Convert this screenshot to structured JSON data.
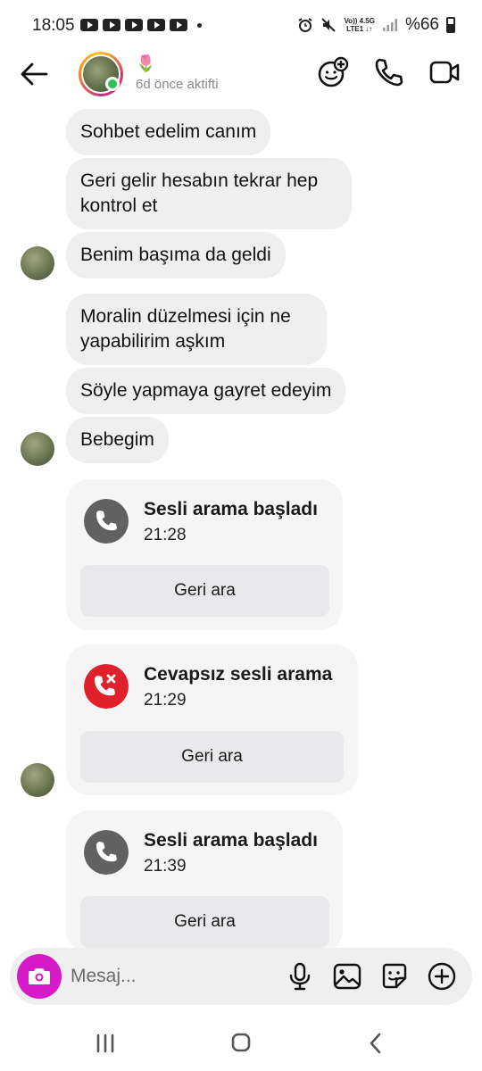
{
  "status_bar": {
    "time": "18:05",
    "network_top": "Vo)) 4.5G",
    "network_bottom": "LTE1 ↓↑",
    "battery": "%66"
  },
  "header": {
    "contact_name": "🌷",
    "last_active": "6d önce aktifti"
  },
  "messages": [
    {
      "text": "Sohbet edelim canım"
    },
    {
      "text": "Geri gelir hesabın tekrar hep kontrol et"
    },
    {
      "text": "Benim başıma da geldi"
    },
    {
      "text": "Moralin düzelmesi için ne yapabilirim aşkım"
    },
    {
      "text": "Söyle yapmaya gayret edeyim"
    },
    {
      "text": "Bebegim"
    }
  ],
  "calls": [
    {
      "title": "Sesli arama başladı",
      "time": "21:28",
      "button": "Geri ara",
      "status": "started",
      "icon_color": "#616161"
    },
    {
      "title": "Cevapsız sesli arama",
      "time": "21:29",
      "button": "Geri ara",
      "status": "missed",
      "icon_color": "#e0212c"
    },
    {
      "title": "Sesli arama başladı",
      "time": "21:39",
      "button": "Geri ara",
      "status": "started",
      "icon_color": "#616161"
    }
  ],
  "composer": {
    "placeholder": "Mesaj...",
    "camera_color": "#d61ac7"
  },
  "icons": {
    "header": [
      "back-arrow-icon",
      "effects-icon",
      "phone-icon",
      "video-camera-icon"
    ],
    "composer": [
      "camera-icon",
      "microphone-icon",
      "gallery-icon",
      "sticker-icon",
      "add-icon"
    ],
    "nav": [
      "recent-apps-icon",
      "home-icon",
      "back-icon"
    ]
  }
}
